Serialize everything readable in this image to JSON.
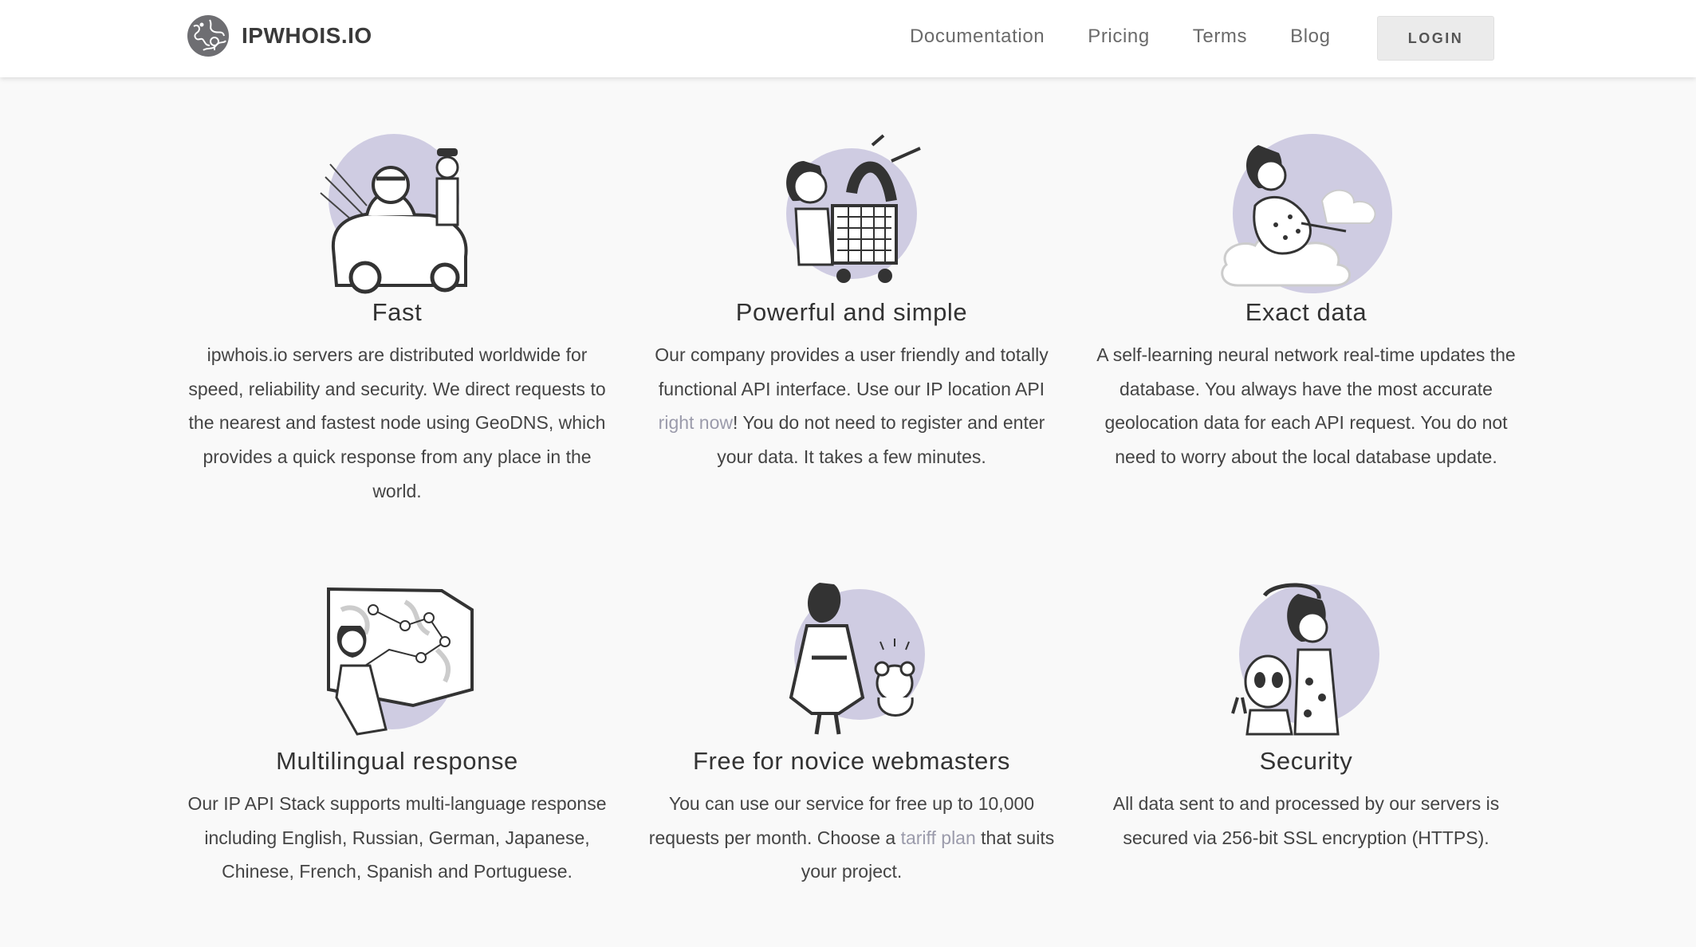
{
  "brand": {
    "name": "IPWHOIS.IO",
    "accent": "#cfcce2",
    "ink": "#3a3a3a"
  },
  "nav": {
    "items": [
      {
        "label": "Documentation"
      },
      {
        "label": "Pricing"
      },
      {
        "label": "Terms"
      },
      {
        "label": "Blog"
      }
    ],
    "login_label": "LOGIN"
  },
  "features": [
    {
      "title": "Fast",
      "illustration": "woman-driving-car-with-pilot-icon",
      "text": [
        "ipwhois.io servers are distributed worldwide for speed, reliability and security. We direct requests to the nearest and fastest node using GeoDNS, which provides a quick response from any place in the world."
      ]
    },
    {
      "title": "Powerful and simple",
      "illustration": "woman-with-shopping-cart-icon",
      "text_before": "Our company provides a user friendly and totally functional API interface. Use our IP location API ",
      "link": "right now",
      "text_after": "! You do not need to register and enter your data. It takes a few minutes."
    },
    {
      "title": "Exact data",
      "illustration": "woman-on-cloud-icon",
      "text": [
        "A self-learning neural network real-time updates the database. You always have the most accurate geolocation data for each API request. You do not need to worry about the local database update."
      ]
    },
    {
      "title": "Multilingual response",
      "illustration": "woman-at-world-map-icon",
      "text": [
        "Our IP API Stack supports multi-language response including English, Russian, German, Japanese, Chinese, French, Spanish and Portuguese."
      ]
    },
    {
      "title": "Free for novice webmasters",
      "illustration": "woman-with-teddy-bear-icon",
      "text_before": "You can use our service for free up to 10,000 requests per month. Choose a ",
      "link": "tariff plan",
      "text_after": " that suits your project."
    },
    {
      "title": "Security",
      "illustration": "woman-with-alien-icon",
      "text": [
        "All data sent to and processed by our servers is secured via 256-bit SSL encryption (HTTPS)."
      ]
    }
  ]
}
